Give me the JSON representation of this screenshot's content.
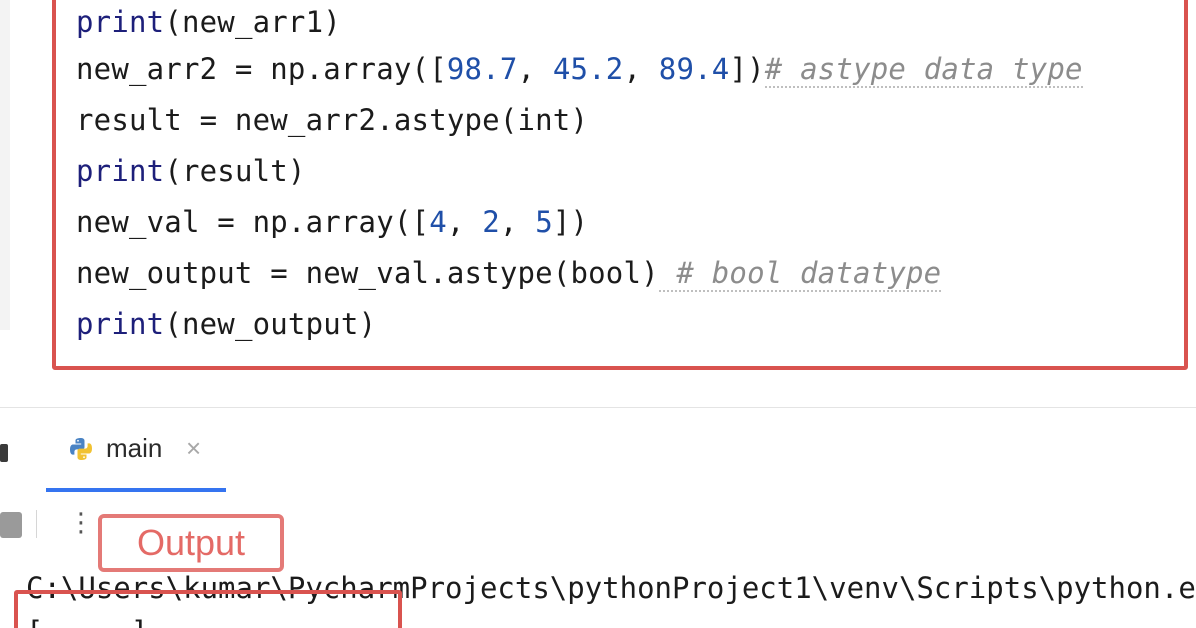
{
  "editor": {
    "lines": [
      [
        {
          "t": "print",
          "c": "kw"
        },
        {
          "t": "(new_arr1)",
          "c": ""
        }
      ],
      [
        {
          "t": "new_arr2 = np.array([",
          "c": ""
        },
        {
          "t": "98.7",
          "c": "num"
        },
        {
          "t": ", ",
          "c": ""
        },
        {
          "t": "45.2",
          "c": "num"
        },
        {
          "t": ", ",
          "c": ""
        },
        {
          "t": "89.4",
          "c": "num"
        },
        {
          "t": "])",
          "c": ""
        },
        {
          "t": "# astype data type",
          "c": "cmt wave"
        }
      ],
      [
        {
          "t": "result = new_arr2.astype(int)",
          "c": ""
        }
      ],
      [
        {
          "t": "print",
          "c": "kw"
        },
        {
          "t": "(result)",
          "c": ""
        }
      ],
      [
        {
          "t": "new_val = np.array([",
          "c": ""
        },
        {
          "t": "4",
          "c": "num"
        },
        {
          "t": ", ",
          "c": ""
        },
        {
          "t": "2",
          "c": "num"
        },
        {
          "t": ", ",
          "c": ""
        },
        {
          "t": "5",
          "c": "num"
        },
        {
          "t": "])",
          "c": ""
        }
      ],
      [
        {
          "t": "new_output = new_val.astype(bool)",
          "c": ""
        },
        {
          "t": " # bool datatype",
          "c": "cmt wave"
        }
      ],
      [
        {
          "t": "print",
          "c": "kw"
        },
        {
          "t": "(new_output)",
          "c": ""
        }
      ]
    ]
  },
  "run_tab": {
    "label": "main",
    "close_glyph": "×"
  },
  "toolbar": {
    "more_glyph": "⋮"
  },
  "annotation": {
    "output_label": "Output"
  },
  "console": {
    "line1": "C:\\Users\\kumar\\PycharmProjects\\pythonProject1\\venv\\Scripts\\python.e",
    "line2": "[ ... ]"
  },
  "colors": {
    "highlight": "#d9534f",
    "tab_accent": "#3574f0",
    "keyword": "#1d1f7a",
    "number": "#1f4fa8",
    "comment": "#8c8c8c"
  },
  "icons": {
    "run_tab_icon": "python-icon",
    "stop": "stop-icon",
    "more": "more-vertical-icon",
    "close": "close-icon"
  }
}
